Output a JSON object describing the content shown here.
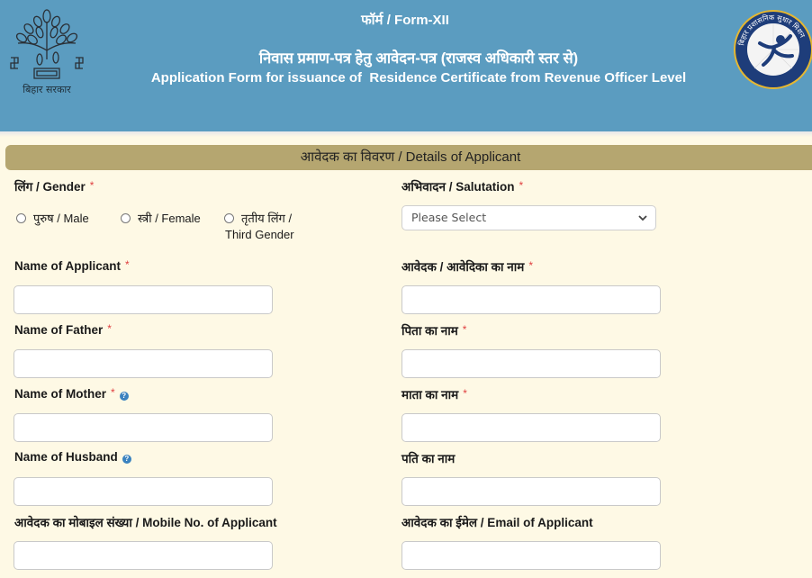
{
  "header": {
    "form_number": "फॉर्म / Form-XII",
    "title_hindi": "निवास प्रमाण-पत्र हेतु आवेदन-पत्र (राजस्व अधिकारी स्तर से)",
    "title_english": "Application Form for issuance of  Residence Certificate from Revenue Officer Level",
    "left_logo_caption": "बिहार सरकार",
    "left_logo_icon": "bihar-government-emblem-icon",
    "right_logo_icon": "bihar-administrative-reform-mission-logo-icon",
    "right_logo_text": "बिहार प्रशासनिक सुधार मिशन"
  },
  "section": {
    "title": "आवेदक का विवरण / Details of Applicant"
  },
  "form": {
    "required_marker": "*",
    "help_glyph": "?",
    "gender": {
      "label": "लिंग / Gender",
      "options": [
        {
          "label": "पुरुष / Male",
          "selected": false
        },
        {
          "label": "स्त्री / Female",
          "selected": false
        },
        {
          "label_line1": "तृतीय लिंग /",
          "label_line2": "Third Gender",
          "selected": false
        }
      ]
    },
    "salutation": {
      "label": "अभिवादन / Salutation",
      "value": "Please Select"
    },
    "name_applicant": {
      "label": "Name of Applicant",
      "value": "",
      "placeholder": ""
    },
    "name_applicant_hindi": {
      "label": "आवेदक / आवेदिका का नाम",
      "value": "",
      "placeholder": ""
    },
    "name_father": {
      "label": "Name of Father",
      "value": "",
      "placeholder": ""
    },
    "name_father_hindi": {
      "label": "पिता का नाम",
      "value": "",
      "placeholder": ""
    },
    "name_mother": {
      "label": "Name of Mother",
      "value": "",
      "placeholder": ""
    },
    "name_mother_hindi": {
      "label": "माता का नाम",
      "value": "",
      "placeholder": ""
    },
    "name_husband": {
      "label": "Name of Husband",
      "value": "",
      "placeholder": ""
    },
    "name_husband_hindi": {
      "label": "पति का नाम",
      "value": "",
      "placeholder": ""
    },
    "mobile": {
      "label": "आवेदक का मोबाइल संख्या / Mobile No. of Applicant",
      "value": "",
      "placeholder": ""
    },
    "email": {
      "label": "आवेदक का ईमेल / Email of Applicant",
      "value": "",
      "placeholder": ""
    }
  },
  "colors": {
    "header_bg": "#5b9cc0",
    "page_bg": "#fef9e5",
    "section_bar_bg": "#b5a670",
    "required": "#e04040",
    "help_icon": "#3a82bf"
  }
}
